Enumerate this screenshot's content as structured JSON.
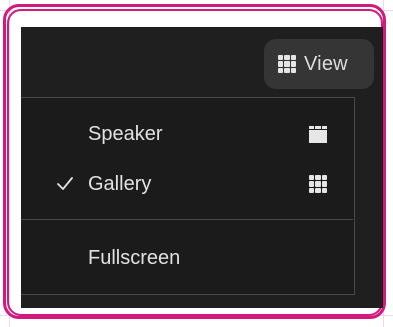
{
  "toolbar": {
    "view_label": "View",
    "view_icon": "grid-icon"
  },
  "menu": {
    "items": [
      {
        "label": "Speaker",
        "checked": false,
        "icon": "speaker-view-icon"
      },
      {
        "label": "Gallery",
        "checked": true,
        "icon": "gallery-view-icon"
      },
      {
        "label": "Fullscreen",
        "checked": false
      }
    ]
  },
  "colors": {
    "highlight_frame": "#d4197e",
    "app_background": "#1f1f1f",
    "menu_background": "#1b1b1b",
    "button_background": "#353535",
    "text": "#e2e2e2",
    "border": "#4a4a4a"
  }
}
